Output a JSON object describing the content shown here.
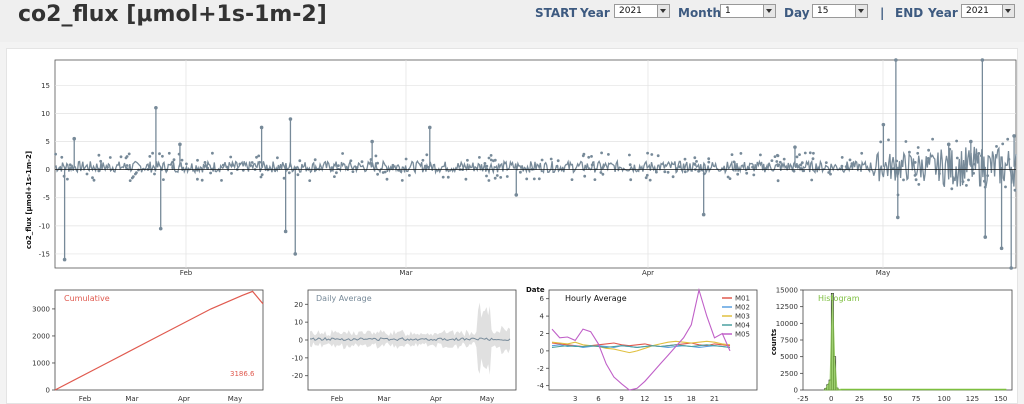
{
  "title": "co2_flux [μmol+1s-1m-2]",
  "controls": {
    "start_label": "START",
    "end_label": "END",
    "separator": "|",
    "year_label": "Year",
    "month_label": "Month",
    "day_label": "Day",
    "start_year": "2021",
    "start_month": "1",
    "start_day": "15",
    "end_year": "2021"
  },
  "colors": {
    "series": "#778a99",
    "cumulative": "#e05a4f",
    "histogram": "#7dbf3f",
    "accent_text": "#3d5a80"
  },
  "main_chart": {
    "ylabel": "co2_flux  [μmol+1s-1m-2]",
    "month_ticks": [
      "Feb",
      "Mar",
      "Apr",
      "May"
    ]
  },
  "cumulative": {
    "title": "Cumulative",
    "final_value": "3186.6"
  },
  "daily": {
    "title": "Daily Average"
  },
  "hourly": {
    "title": "Hourly Average",
    "corner_label": "Date",
    "legend": [
      "M01",
      "M02",
      "M03",
      "M04",
      "M05"
    ]
  },
  "histogram": {
    "title": "Histogram",
    "ylabel": "counts"
  },
  "chart_data": [
    {
      "type": "line",
      "ylabel": "co2_flux  [μmol+1s-1m-2]",
      "ylim": [
        -17.5,
        19.5
      ],
      "yticks": [
        -15,
        -10,
        -5,
        0,
        5,
        10,
        15
      ],
      "xticks": [
        "Feb",
        "Mar",
        "Apr",
        "May"
      ],
      "grid": true,
      "baseline": 0.5,
      "noise_amplitude": 1.0,
      "spikes": [
        {
          "t": 0.01,
          "y": -16
        },
        {
          "t": 0.02,
          "y": 5.5
        },
        {
          "t": 0.105,
          "y": 11
        },
        {
          "t": 0.11,
          "y": -10.5
        },
        {
          "t": 0.13,
          "y": 4.5
        },
        {
          "t": 0.215,
          "y": 7.5
        },
        {
          "t": 0.24,
          "y": -11
        },
        {
          "t": 0.245,
          "y": 9
        },
        {
          "t": 0.25,
          "y": -15
        },
        {
          "t": 0.33,
          "y": 5
        },
        {
          "t": 0.39,
          "y": 7.5
        },
        {
          "t": 0.48,
          "y": -4.5
        },
        {
          "t": 0.675,
          "y": -8
        },
        {
          "t": 0.77,
          "y": 4
        },
        {
          "t": 0.862,
          "y": 8
        },
        {
          "t": 0.875,
          "y": 19.5
        },
        {
          "t": 0.877,
          "y": -8.5
        },
        {
          "t": 0.93,
          "y": 4.5
        },
        {
          "t": 0.953,
          "y": 5
        },
        {
          "t": 0.965,
          "y": 19.5
        },
        {
          "t": 0.968,
          "y": -12
        },
        {
          "t": 0.985,
          "y": -14
        },
        {
          "t": 0.995,
          "y": -17.5
        },
        {
          "t": 0.998,
          "y": 6
        }
      ]
    },
    {
      "type": "line",
      "title": "Cumulative",
      "ylim": [
        0,
        3700
      ],
      "yticks": [
        0,
        1000,
        2000,
        3000
      ],
      "xticks": [
        "Feb",
        "Mar",
        "Apr",
        "May"
      ],
      "x": [
        0.0,
        0.25,
        0.5,
        0.75,
        0.9,
        0.95,
        1.0
      ],
      "y": [
        0,
        1000,
        2000,
        3000,
        3500,
        3650,
        3186.6
      ],
      "annotation": "3186.6"
    },
    {
      "type": "line",
      "title": "Daily Average",
      "ylim": [
        -28,
        28
      ],
      "yticks": [
        -20,
        -10,
        0,
        10,
        20
      ],
      "xticks": [
        "Feb",
        "Mar",
        "Apr",
        "May"
      ],
      "baseline": 0.5
    },
    {
      "type": "line",
      "title": "Hourly Average",
      "ylim": [
        -4.5,
        7
      ],
      "yticks": [
        -4,
        -2,
        0,
        2,
        4,
        6
      ],
      "x": [
        0,
        1,
        2,
        3,
        4,
        5,
        6,
        7,
        8,
        9,
        10,
        11,
        12,
        13,
        14,
        15,
        16,
        17,
        18,
        19,
        20,
        21,
        22,
        23
      ],
      "xticks": [
        3,
        6,
        9,
        12,
        15,
        18,
        21
      ],
      "series": [
        {
          "name": "M01",
          "values": [
            0.9,
            0.8,
            0.7,
            0.6,
            0.5,
            0.6,
            0.7,
            0.8,
            0.9,
            0.7,
            0.6,
            0.7,
            0.8,
            0.6,
            0.5,
            0.6,
            0.7,
            0.8,
            0.9,
            0.7,
            0.6,
            0.8,
            0.7,
            0.6
          ]
        },
        {
          "name": "M02",
          "values": [
            0.6,
            0.7,
            0.5,
            0.6,
            0.4,
            0.5,
            0.6,
            0.5,
            0.4,
            0.6,
            0.5,
            0.4,
            0.5,
            0.6,
            0.5,
            0.4,
            0.5,
            0.6,
            0.5,
            0.4,
            0.5,
            0.6,
            0.5,
            0.4
          ]
        },
        {
          "name": "M03",
          "values": [
            1.0,
            0.9,
            0.8,
            1.0,
            0.7,
            0.6,
            0.5,
            0.3,
            0.2,
            0.0,
            -0.2,
            0.0,
            0.3,
            0.6,
            0.8,
            1.0,
            1.1,
            1.0,
            0.9,
            1.0,
            1.1,
            1.0,
            0.8,
            0.7
          ]
        },
        {
          "name": "M04",
          "values": [
            0.4,
            0.5,
            0.6,
            0.5,
            0.5,
            0.6,
            0.5,
            0.4,
            0.5,
            0.6,
            0.5,
            0.4,
            0.5,
            0.6,
            0.5,
            0.6,
            0.7,
            0.6,
            0.5,
            0.6,
            0.7,
            0.6,
            0.5,
            0.4
          ]
        },
        {
          "name": "M05",
          "values": [
            2.5,
            1.5,
            1.6,
            1.2,
            2.5,
            2.2,
            0.8,
            -1.5,
            -3.0,
            -3.8,
            -4.5,
            -4.3,
            -3.5,
            -2.5,
            -1.5,
            -0.5,
            0.5,
            1.5,
            3.0,
            7.0,
            4.0,
            1.5,
            2.0,
            0.0
          ]
        }
      ]
    },
    {
      "type": "bar",
      "title": "Histogram",
      "ylabel": "counts",
      "ylim": [
        0,
        15000
      ],
      "yticks": [
        0,
        2500,
        5000,
        7500,
        10000,
        12500,
        15000
      ],
      "xlim": [
        -25,
        160
      ],
      "xticks": [
        -25,
        0,
        25,
        50,
        75,
        100,
        125,
        150
      ],
      "bins": [
        -6,
        -4,
        -2,
        0,
        2,
        4
      ],
      "values": [
        200,
        800,
        1500,
        14500,
        5000,
        300
      ]
    }
  ]
}
